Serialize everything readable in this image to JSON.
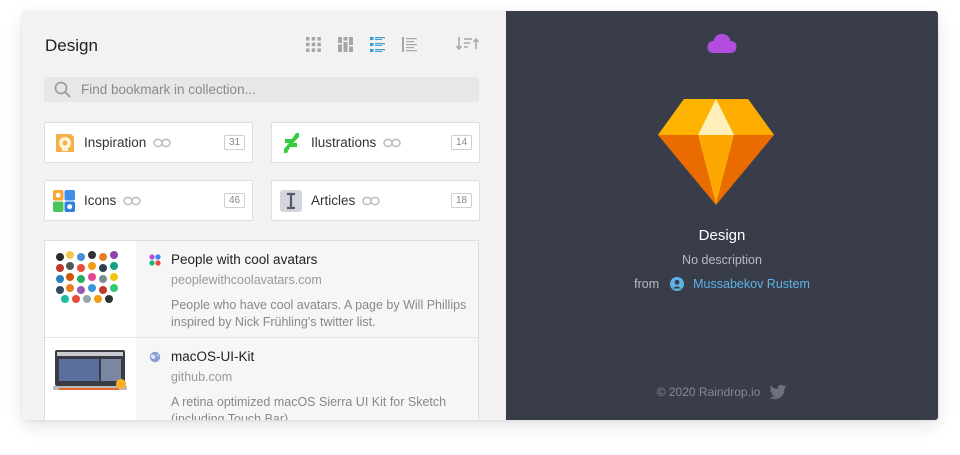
{
  "collection": {
    "title": "Design",
    "view_modes": [
      "grid-icon",
      "masonry-icon",
      "list-icon",
      "simple-list-icon"
    ],
    "active_view": "list-icon"
  },
  "search": {
    "placeholder": "Find bookmark in collection..."
  },
  "subcollections": [
    {
      "label": "Inspiration",
      "count": "31",
      "icon": "lightbulb-head-icon"
    },
    {
      "label": "Ilustrations",
      "count": "14",
      "icon": "deviantart-icon"
    },
    {
      "label": "Icons",
      "count": "46",
      "icon": "icon-grid-icon"
    },
    {
      "label": "Articles",
      "count": "18",
      "icon": "text-cursor-icon"
    }
  ],
  "bookmarks": [
    {
      "title": "People with cool avatars",
      "domain": "peoplewithcoolavatars.com",
      "description": "People who have cool avatars. A page by Will Phillips inspired by Nick Frühling's twitter list."
    },
    {
      "title": "macOS-UI-Kit",
      "domain": "github.com",
      "description": "A retina optimized macOS Sierra UI Kit for Sketch (including Touch Bar)"
    }
  ],
  "panel": {
    "name": "Design",
    "description": "No description",
    "from_label": "from",
    "author": "Mussabekov Rustem",
    "copyright": "© 2020 Raindrop.io"
  },
  "colors": {
    "accent": "#5db3e6",
    "panel_bg": "#393c49",
    "cloud": "#b14ee0",
    "gem_top": "#fdd231",
    "gem_mid": "#fea700",
    "gem_side": "#ea6c00"
  }
}
